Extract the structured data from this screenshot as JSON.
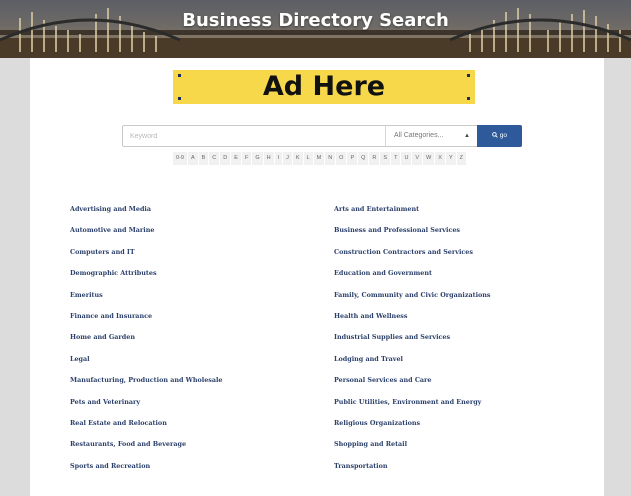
{
  "header": {
    "title": "Business Directory Search"
  },
  "ad": {
    "label": "Ad Here"
  },
  "search": {
    "placeholder": "Keyword",
    "category_value": "All Categories...",
    "go_label": "go"
  },
  "alphabet": [
    "0-9",
    "A",
    "B",
    "C",
    "D",
    "E",
    "F",
    "G",
    "H",
    "I",
    "J",
    "K",
    "L",
    "M",
    "N",
    "O",
    "P",
    "Q",
    "R",
    "S",
    "T",
    "U",
    "V",
    "W",
    "X",
    "Y",
    "Z"
  ],
  "categories": {
    "left": [
      "Advertising and Media",
      "Automotive and Marine",
      "Computers and IT",
      "Demographic Attributes",
      "Emeritus",
      "Finance and Insurance",
      "Home and Garden",
      "Legal",
      "Manufacturing, Production and Wholesale",
      "Pets and Veterinary",
      "Real Estate and Relocation",
      "Restaurants, Food and Beverage",
      "Sports and Recreation"
    ],
    "right": [
      "Arts and Entertainment",
      "Business and Professional Services",
      "Construction Contractors and Services",
      "Education and Government",
      "Family, Community and Civic Organizations",
      "Health and Wellness",
      "Industrial Supplies and Services",
      "Lodging and Travel",
      "Personal Services and Care",
      "Public Utilities, Environment and Energy",
      "Religious Organizations",
      "Shopping and Retail",
      "Transportation"
    ]
  },
  "colors": {
    "ad_background": "#f6d84a",
    "button": "#2e5a9b",
    "link": "#2a3f6a"
  },
  "icons": {
    "search": "search-icon",
    "select": "chevron-down-icon"
  }
}
